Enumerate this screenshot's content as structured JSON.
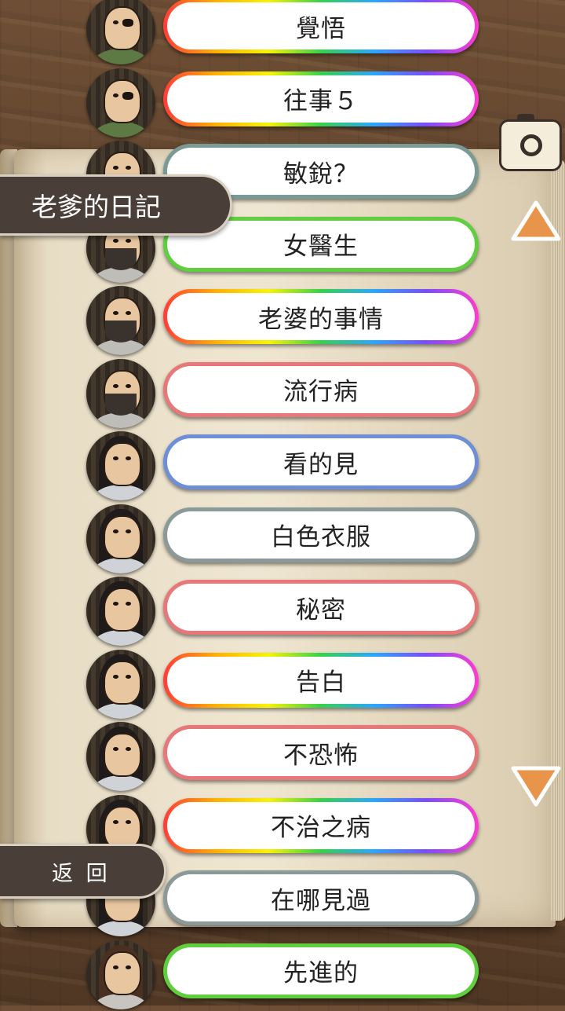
{
  "screen": {
    "title": "老爹的日記",
    "back_label": "返 回"
  },
  "entries": [
    {
      "label": "覺悟",
      "border": "rainbow",
      "avatar": "eyepatch-man"
    },
    {
      "label": "往事５",
      "border": "rainbow",
      "avatar": "eyepatch-man"
    },
    {
      "label": "敏銳？",
      "border": "teal",
      "avatar": "bearded-man"
    },
    {
      "label": "女醫生",
      "border": "green",
      "avatar": "bearded-man"
    },
    {
      "label": "老婆的事情",
      "border": "rainbow",
      "avatar": "bearded-man"
    },
    {
      "label": "流行病",
      "border": "red",
      "avatar": "bearded-man"
    },
    {
      "label": "看的見",
      "border": "blue",
      "avatar": "long-hair-woman"
    },
    {
      "label": "白色衣服",
      "border": "gray",
      "avatar": "long-hair-woman"
    },
    {
      "label": "秘密",
      "border": "red",
      "avatar": "long-hair-woman"
    },
    {
      "label": "告白",
      "border": "rainbow",
      "avatar": "long-hair-woman"
    },
    {
      "label": "不恐怖",
      "border": "red",
      "avatar": "long-hair-woman"
    },
    {
      "label": "不治之病",
      "border": "rainbow",
      "avatar": "long-hair-woman"
    },
    {
      "label": "在哪見過",
      "border": "gray",
      "avatar": "long-hair-woman"
    },
    {
      "label": "先進的",
      "border": "green",
      "avatar": "brown-hair-woman"
    }
  ],
  "icons": {
    "camera": "camera-icon",
    "up": "scroll-up-arrow-icon",
    "down": "scroll-down-arrow-icon"
  },
  "colors": {
    "accent_arrow": "#e8944a",
    "tab_bg": "#4a3f38"
  }
}
